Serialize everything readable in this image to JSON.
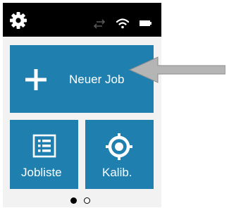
{
  "status_bar": {
    "icons": [
      "gear-icon",
      "sync-icon",
      "wifi-icon",
      "battery-icon"
    ]
  },
  "tiles": {
    "new_job": {
      "label": "Neuer Job",
      "icon": "plus-icon"
    },
    "job_list": {
      "label": "Jobliste",
      "icon": "list-icon"
    },
    "calibrate": {
      "label": "Kalib.",
      "icon": "crosshair-icon"
    }
  },
  "pagination": {
    "pages": 2,
    "current": 1
  },
  "colors": {
    "tile": "#1f80b0",
    "status_bar": "#000000",
    "background": "#f2f2f2",
    "annotation_arrow": "#b5b5b5"
  }
}
